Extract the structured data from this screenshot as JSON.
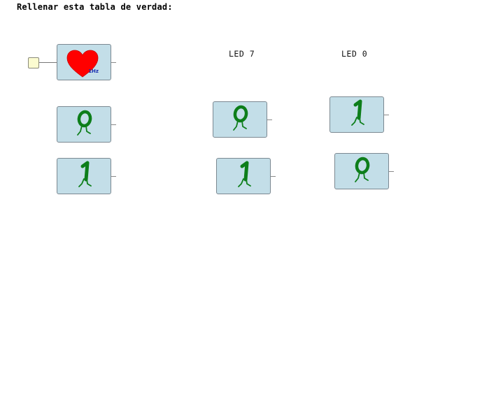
{
  "page": {
    "title": "Rellenar esta tabla de verdad:"
  },
  "columns": {
    "led7": "LED 7",
    "led0": "LED 0"
  },
  "clock": {
    "label": "1Hz",
    "heart_color": "#ff0000"
  },
  "colors": {
    "digit": "#0d7e1a",
    "block_bg": "#c3dee8",
    "block_border": "#7b8891",
    "port_bg": "#fbfbd0"
  },
  "rows": [
    {
      "input": "0",
      "led7": "0",
      "led0": "1"
    },
    {
      "input": "1",
      "led7": "1",
      "led0": "0"
    }
  ]
}
